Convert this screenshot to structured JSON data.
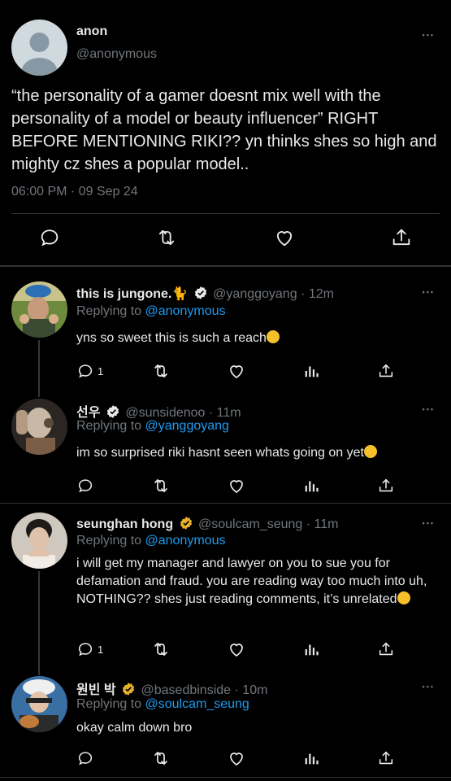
{
  "main_tweet": {
    "name": "anon",
    "handle": "@anonymous",
    "text": "“the personality of a gamer doesnt mix well with the personality of a model or beauty influencer” RIGHT BEFORE MENTIONING RIKI?? yn thinks shes so high and mighty cz shes a popular model..",
    "timestamp": "06:00 PM · 09 Sep 24",
    "more": "•••"
  },
  "replies": [
    {
      "name": "this is jungone.🐈",
      "handle": "@yanggoyang",
      "time": "· 12m",
      "replying_prefix": "Replying to ",
      "replying_to": "@anonymous",
      "text": "yns so sweet this is such a reach",
      "reply_count": "1",
      "badge": "verified-blue"
    },
    {
      "name": "선우",
      "handle": "@sunsidenoo",
      "time": "· 11m",
      "replying_prefix": "Replying to ",
      "replying_to": "@yanggoyang",
      "text": "im so surprised riki hasnt seen whats going on yet",
      "reply_count": "",
      "badge": "verified-blue"
    },
    {
      "name": "seunghan hong",
      "handle": "@soulcam_seung",
      "time": "· 11m",
      "replying_prefix": "Replying to ",
      "replying_to": "@anonymous",
      "text": "i will get my manager and lawyer on you to sue you for defamation and fraud. you are reading way too much into uh, NOTHING?? shes just reading comments, it’s unrelated",
      "reply_count": "1",
      "badge": "verified-gold"
    },
    {
      "name": "원빈 박",
      "handle": "@basedbinside",
      "time": "· 10m",
      "replying_prefix": "Replying to ",
      "replying_to": "@soulcam_seung",
      "text": "okay calm down bro",
      "reply_count": "",
      "badge": "verified-gold"
    }
  ],
  "colors": {
    "background": "#000000",
    "text": "#e7e9ea",
    "muted": "#71767b",
    "link": "#1d9bf0",
    "border": "#2f3336",
    "gold": "#e8b129"
  },
  "icons": [
    "more-icon",
    "reply-icon",
    "retweet-icon",
    "like-icon",
    "views-icon",
    "share-icon",
    "verified-badge-icon"
  ]
}
